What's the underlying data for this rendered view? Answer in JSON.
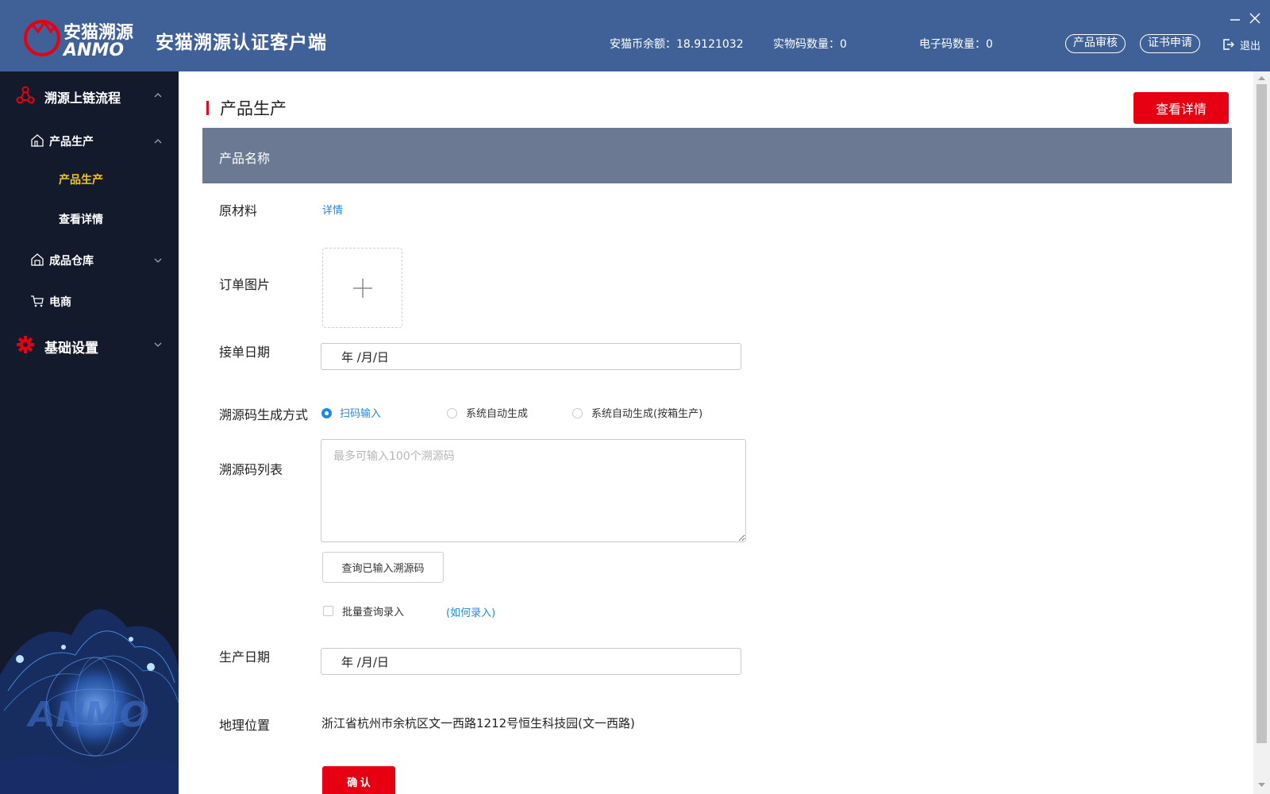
{
  "header": {
    "logo_cn": "安猫溯源",
    "logo_en": "ANMO",
    "app_title": "安猫溯源认证客户端",
    "balance": "安猫币余额：18.9121032",
    "physical_count": "实物码数量：0",
    "electronic_count": "电子码数量：0",
    "review_button": "产品审核",
    "certificate_button": "证书申请",
    "logout_label": "退出"
  },
  "sidebar": {
    "group1": "溯源上链流程",
    "product_production": "产品生产",
    "sub_production": "产品生产",
    "sub_view_details": "查看详情",
    "warehouse": "成品仓库",
    "ecommerce": "电商",
    "group2": "基础设置",
    "active_color": "#f5c518"
  },
  "main": {
    "section_title": "产品生产",
    "view_details_button": "查看详情",
    "product_name_header": "产品名称",
    "raw_material_label": "原材料",
    "raw_material_link": "详情",
    "order_image_label": "订单图片",
    "receive_date_label": "接单日期",
    "receive_date_value": "年 /月/日",
    "code_method_label": "溯源码生成方式",
    "code_methods": [
      "扫码输入",
      "系统自动生成",
      "系统自动生成(按箱生产)"
    ],
    "code_list_label": "溯源码列表",
    "code_list_placeholder": "最多可输入100个溯源码",
    "query_button": "查询已输入溯源码",
    "batch_query_label": "批量查询录入",
    "how_to_link": "(如何录入)",
    "production_date_label": "生产日期",
    "production_date_value": "年 /月/日",
    "location_label": "地理位置",
    "location_value": "浙江省杭州市余杭区文一西路1212号恒生科技园(文一西路)",
    "confirm_button": "确 认",
    "accent_red": "#e60012",
    "link_blue": "#1e88e5"
  }
}
